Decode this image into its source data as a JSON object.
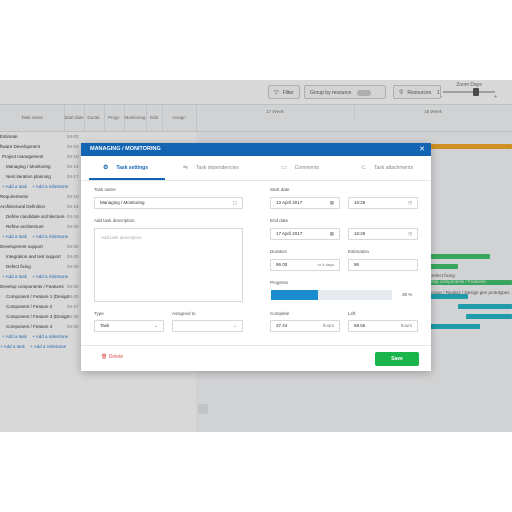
{
  "toolbar": {
    "filter_label": "Filter",
    "group_label": "Group by resource",
    "resources_label": "Resources",
    "resources_count": "1",
    "zoom_label": "Zoom Days",
    "zoom_min": "-",
    "zoom_max": "+"
  },
  "grid": {
    "col_task": "Task name",
    "col_start": "Start date",
    "col_duration": "Durati.",
    "col_progress": "Progr.",
    "col_monitoring": "Monitoring",
    "col_edit": "Edit",
    "col_assign": "Assign",
    "week1": "17 Week",
    "week2": "18 Week",
    "rows": [
      {
        "name": "Estimate",
        "id": "04-03"
      },
      {
        "name": "ftware Development",
        "id": "04-10"
      },
      {
        "name": "Project management",
        "id": "04-10"
      },
      {
        "name": "Managing / Monitoring",
        "id": "04-13"
      },
      {
        "name": "Next iteration planning",
        "id": "04-17"
      },
      {
        "name": "+ Add a task",
        "id": "",
        "link": "+ Add a milestone"
      },
      {
        "name": "Requirements",
        "id": "04-10"
      },
      {
        "name": "Architectural Definition",
        "id": "04-18"
      },
      {
        "name": "Define candidate architecture",
        "id": "04-18"
      },
      {
        "name": "Refine architecture",
        "id": "04-20"
      },
      {
        "name": "+ Add a task",
        "id": "",
        "link": "+ Add a milestone"
      },
      {
        "name": "Development support",
        "id": "04-20"
      },
      {
        "name": "Integration and test support",
        "id": "04-20"
      },
      {
        "name": "Defect fixing",
        "id": "04-20"
      },
      {
        "name": "+ Add a task",
        "id": "",
        "link": "+ Add a milestone"
      },
      {
        "name": "Develop components / Features",
        "id": "04-20"
      },
      {
        "name": "Component / Feature 1 (Design",
        "id": "04-20"
      },
      {
        "name": "Component / Feature 2",
        "id": "04-27"
      },
      {
        "name": "Component / Feature 3 (Design",
        "id": "04-20"
      },
      {
        "name": "Component / Feature 4",
        "id": "04-20"
      },
      {
        "name": "+ Add a task",
        "id": "",
        "link": "+ Add a milestone"
      },
      {
        "name": "+ Add a task",
        "id": "",
        "link": "+ Add a milestone"
      }
    ]
  },
  "timeline": {
    "label_feature": "elop components / Features",
    "label_design": "Design / Realize / Design gen prototypes",
    "label_defect": "Defect fixing"
  },
  "modal": {
    "title": "MANAGING / MONITORING",
    "close_icon": "close-icon",
    "tabs": [
      "Task settings",
      "Task dependencies",
      "Comments",
      "Task attachments"
    ],
    "task_name_label": "Task name",
    "task_name_value": "Managing / Monitoring",
    "description_label": "Add task description",
    "description_placeholder": "Add task description",
    "start_label": "Start date",
    "start_date": "13 April 2017",
    "start_time": "16:26",
    "end_label": "End date",
    "end_date": "17 April 2017",
    "end_time": "16:26",
    "duration_label": "Duration",
    "duration_value": "96.00",
    "duration_unit": "or 4 days",
    "estimation_label": "Estimation",
    "estimation_value": "96",
    "progress_label": "Progress",
    "progress_value": 0.39,
    "progress_text": "39 %",
    "type_label": "Type",
    "type_value": "Task",
    "assigned_label": "Assigned to",
    "assigned_value": "",
    "complete_label": "Complete",
    "complete_value": "37.44",
    "complete_unit": "hours",
    "left_label": "Left",
    "left_value": "58.56",
    "left_unit": "hours",
    "delete_label": "Delete",
    "save_label": "Save"
  },
  "colors": {
    "header_blue": "#1464b4",
    "save_green": "#19b44a",
    "delete_red": "#d9534f",
    "bar_teal": "#1fb5c4",
    "bar_green": "#3cc36a",
    "bar_orange": "#f5a623",
    "bar_blue": "#1a8ccf"
  }
}
